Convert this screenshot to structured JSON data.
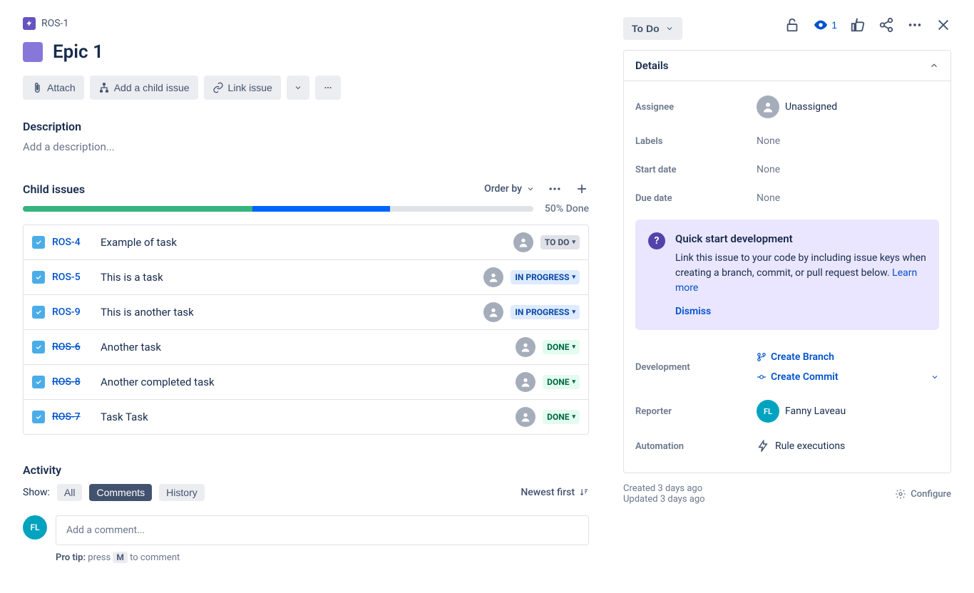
{
  "breadcrumb": {
    "key": "ROS-1"
  },
  "title": "Epic 1",
  "header": {
    "watchers": "1"
  },
  "toolbar": {
    "attach": "Attach",
    "add_child": "Add a child issue",
    "link": "Link issue"
  },
  "description": {
    "label": "Description",
    "placeholder": "Add a description..."
  },
  "child": {
    "label": "Child issues",
    "order_by": "Order by",
    "progress": {
      "done_pct": 45,
      "inprogress_pct": 27,
      "label": "50% Done"
    },
    "items": [
      {
        "key": "ROS-4",
        "summary": "Example of task",
        "status": "TO DO",
        "status_cls": "todo",
        "done": false
      },
      {
        "key": "ROS-5",
        "summary": "This is a task",
        "status": "IN PROGRESS",
        "status_cls": "inprogress",
        "done": false
      },
      {
        "key": "ROS-9",
        "summary": "This is another task",
        "status": "IN PROGRESS",
        "status_cls": "inprogress",
        "done": false
      },
      {
        "key": "ROS-6",
        "summary": "Another task",
        "status": "DONE",
        "status_cls": "done",
        "done": true
      },
      {
        "key": "ROS-8",
        "summary": "Another completed task",
        "status": "DONE",
        "status_cls": "done",
        "done": true
      },
      {
        "key": "ROS-7",
        "summary": "Task Task",
        "status": "DONE",
        "status_cls": "done",
        "done": true
      }
    ]
  },
  "activity": {
    "label": "Activity",
    "show": "Show:",
    "tabs": {
      "all": "All",
      "comments": "Comments",
      "history": "History"
    },
    "newest_first": "Newest first",
    "comment_placeholder": "Add a comment...",
    "avatar_initials": "FL",
    "protip_prefix": "Pro tip:",
    "protip_press": "press",
    "protip_key": "M",
    "protip_suffix": "to comment"
  },
  "status": "To Do",
  "details": {
    "label": "Details",
    "assignee": {
      "label": "Assignee",
      "value": "Unassigned"
    },
    "labels": {
      "label": "Labels",
      "value": "None"
    },
    "start_date": {
      "label": "Start date",
      "value": "None"
    },
    "due_date": {
      "label": "Due date",
      "value": "None"
    },
    "development": {
      "label": "Development",
      "create_branch": "Create Branch",
      "create_commit": "Create Commit"
    },
    "reporter": {
      "label": "Reporter",
      "value": "Fanny Laveau",
      "initials": "FL"
    },
    "automation": {
      "label": "Automation",
      "value": "Rule executions"
    }
  },
  "info_box": {
    "title": "Quick start development",
    "body": "Link this issue to your code by including issue keys when creating a branch, commit, or pull request below.",
    "learn_more": "Learn more",
    "dismiss": "Dismiss"
  },
  "meta": {
    "created": "Created 3 days ago",
    "updated": "Updated 3 days ago",
    "configure": "Configure"
  }
}
